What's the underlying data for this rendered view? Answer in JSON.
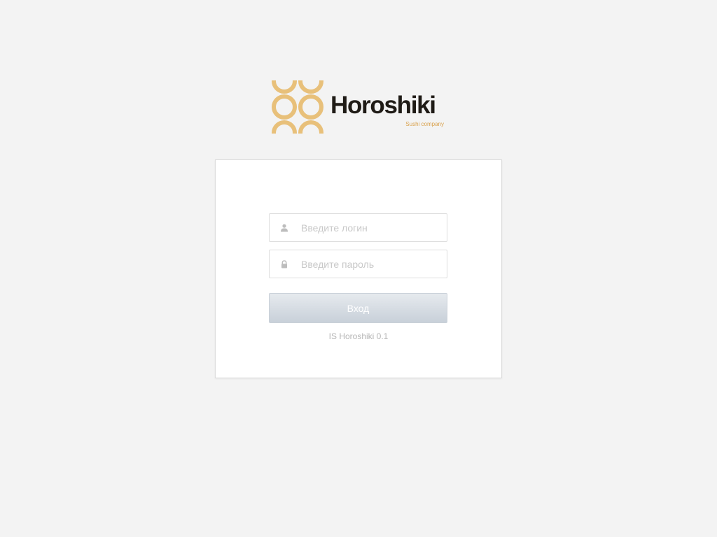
{
  "logo": {
    "name": "Horoshiki",
    "tagline": "Sushi company",
    "brand_color": "#e8c07a",
    "text_color": "#1f1b16"
  },
  "login_form": {
    "login_placeholder": "Введите логин",
    "login_icon": "user-icon",
    "password_placeholder": "Введите пароль",
    "password_icon": "lock-icon",
    "submit_label": "Вход",
    "version_text": "IS Horoshiki 0.1"
  }
}
